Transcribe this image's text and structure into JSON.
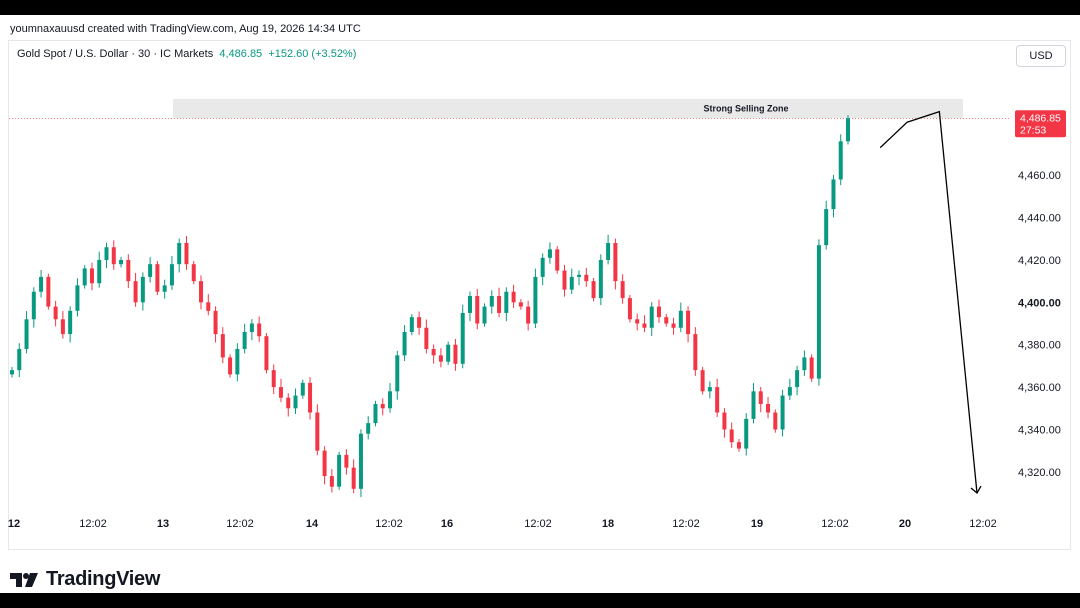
{
  "header": {
    "text": "youmnaxauusd created with TradingView.com, Aug 19, 2026 14:34 UTC"
  },
  "legend": {
    "symbol": "Gold Spot / U.S. Dollar · 30 · IC Markets",
    "price": "4,486.85",
    "change": "+152.60 (+3.52%)"
  },
  "currency": "USD",
  "zone_label": "Strong Selling Zone",
  "price_tag": {
    "price": "4,486.85",
    "countdown": "27:53"
  },
  "brand": {
    "name": "TradingView",
    "logo_icon": "tradingview-logo-icon"
  },
  "colors": {
    "up": "#089981",
    "down": "#f23645",
    "zone": "#e9e9ea",
    "tag": "#f23645"
  },
  "chart_data": {
    "type": "candlestick",
    "title": "",
    "y_ticks": [
      "4,460.00",
      "4,440.00",
      "4,420.00",
      "4,400.00",
      "4,380.00",
      "4,360.00",
      "4,340.00",
      "4,320.00"
    ],
    "y_tick_values": [
      4460,
      4440,
      4420,
      4400,
      4380,
      4360,
      4340,
      4320
    ],
    "bold_tick": "4,400.00",
    "ylim": [
      4302,
      4512
    ],
    "x_ticks": [
      "12",
      "12:02",
      "13",
      "12:02",
      "14",
      "12:02",
      "16",
      "12:02",
      "18",
      "12:02",
      "19",
      "12:02",
      "20",
      "12:02"
    ],
    "x_tick_bold": [
      true,
      false,
      true,
      false,
      true,
      false,
      true,
      false,
      true,
      false,
      true,
      false,
      true,
      false
    ],
    "close_path": [
      4368,
      4378,
      4392,
      4405,
      4412,
      4398,
      4392,
      4385,
      4396,
      4408,
      4416,
      4409,
      4420,
      4426,
      4418,
      4420,
      4410,
      4400,
      4412,
      4418,
      4405,
      4408,
      4418,
      4428,
      4418,
      4410,
      4400,
      4396,
      4385,
      4374,
      4366,
      4378,
      4386,
      4390,
      4384,
      4368,
      4360,
      4355,
      4350,
      4356,
      4362,
      4348,
      4330,
      4318,
      4313,
      4328,
      4322,
      4312,
      4338,
      4343,
      4352,
      4350,
      4358,
      4375,
      4386,
      4393,
      4388,
      4378,
      4375,
      4372,
      4380,
      4371,
      4395,
      4403,
      4390,
      4398,
      4403,
      4395,
      4405,
      4400,
      4398,
      4390,
      4412,
      4421,
      4425,
      4415,
      4406,
      4412,
      4413,
      4410,
      4402,
      4420,
      4428,
      4410,
      4402,
      4392,
      4390,
      4388,
      4398,
      4393,
      4390,
      4388,
      4396,
      4385,
      4368,
      4358,
      4360,
      4348,
      4340,
      4334,
      4331,
      4345,
      4358,
      4352,
      4348,
      4340,
      4356,
      4360,
      4368,
      4374,
      4364,
      4427,
      4444,
      4458,
      4476,
      4486.85
    ],
    "zone": {
      "from": 4487,
      "to": 4496
    },
    "projection": [
      [
        4492,
        4473
      ],
      [
        4497,
        4485
      ],
      [
        4503,
        4490
      ],
      [
        4510,
        4310
      ]
    ]
  }
}
